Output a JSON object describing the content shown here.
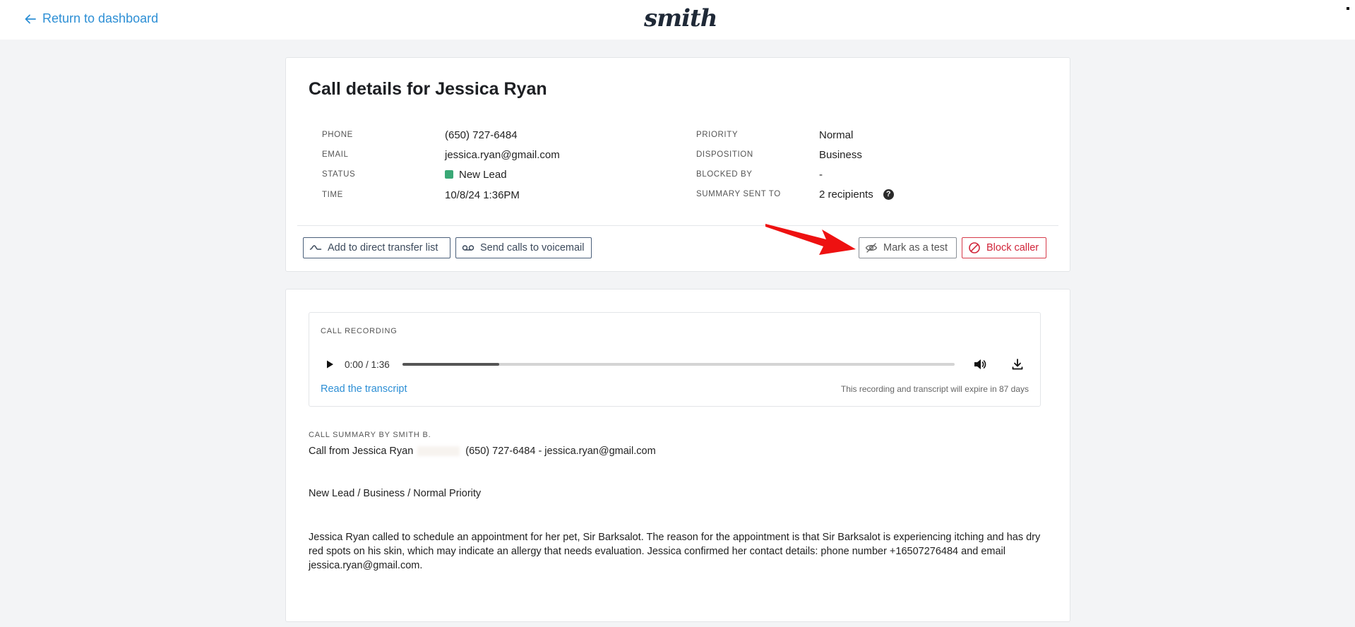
{
  "header": {
    "back_label": "Return to dashboard",
    "logo_text": "smith"
  },
  "call": {
    "title": "Call details for Jessica Ryan",
    "left_fields": [
      {
        "key": "PHONE",
        "value": "(650) 727-6484"
      },
      {
        "key": "EMAIL",
        "value": "jessica.ryan@gmail.com"
      },
      {
        "key": "STATUS",
        "value": "New Lead"
      },
      {
        "key": "TIME",
        "value": "10/8/24 1:36PM"
      }
    ],
    "right_fields": [
      {
        "key": "PRIORITY",
        "value": "Normal"
      },
      {
        "key": "DISPOSITION",
        "value": "Business"
      },
      {
        "key": "BLOCKED BY",
        "value": "-"
      },
      {
        "key": "SUMMARY SENT TO",
        "value": "2 recipients"
      }
    ],
    "help_icon_glyph": "?",
    "status_color": "#3aa876"
  },
  "actions": {
    "direct_transfer_label": "Add to direct transfer list",
    "voicemail_label": "Send calls to voicemail",
    "mark_test_label": "Mark as a test",
    "block_label": "Block caller"
  },
  "recording": {
    "label": "CALL RECORDING",
    "time": "0:00 / 1:36",
    "progress_fraction": 0.175,
    "transcript_link": "Read the transcript",
    "expire_note": "This recording and transcript will expire in 87 days"
  },
  "summary": {
    "label": "CALL SUMMARY BY SMITH B.",
    "caller_prefix": "Call from Jessica Ryan",
    "contact": "(650) 727-6484 - jessica.ryan@gmail.com",
    "tags": "New Lead / Business / Normal Priority",
    "text": "Jessica Ryan called to schedule an appointment for her pet, Sir Barksalot. The reason for the appointment is that Sir Barksalot is experiencing itching and has dry red spots on his skin, which may indicate an allergy that needs evaluation. Jessica confirmed her contact details: phone number +16507276484 and email jessica.ryan@gmail.com."
  },
  "colors": {
    "link": "#2d8fd5",
    "danger": "#d1253a",
    "annotation_arrow": "#ee1111"
  }
}
